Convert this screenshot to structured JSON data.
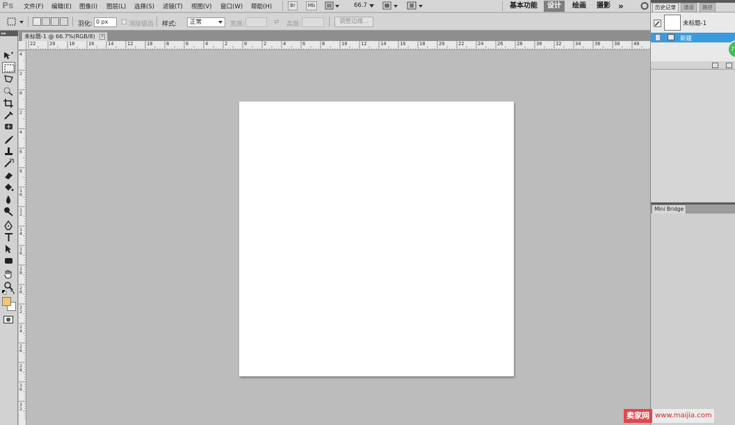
{
  "app": {
    "logo": "Ps",
    "menus": [
      "文件(F)",
      "编辑(E)",
      "图像(I)",
      "图层(L)",
      "选择(S)",
      "滤镜(T)",
      "视图(V)",
      "窗口(W)",
      "帮助(H)"
    ],
    "launch_bridge": "Br",
    "launch_minibridge": "Mb",
    "zoom": "66.7",
    "workspaces": [
      "基本功能",
      "设计",
      "绘画",
      "摄影"
    ],
    "active_workspace": "设计",
    "more_glyph": "»"
  },
  "options": {
    "feather_label": "羽化:",
    "feather_value": "0 px",
    "antialias_label": "消除锯齿",
    "style_label": "样式:",
    "style_value": "正常",
    "width_label": "宽度:",
    "height_label": "高度:",
    "refine_edge_label": "调整边缘..."
  },
  "document": {
    "tab_title": "未标题-1 @ 66.7%(RGB/8)",
    "close_glyph": "×",
    "canvas_color": "#ffffff"
  },
  "rulers": {
    "horizontal": [
      "22",
      "20",
      "18",
      "16",
      "14",
      "12",
      "10",
      "8",
      "6",
      "4",
      "2",
      "0",
      "2",
      "4",
      "6",
      "8",
      "10",
      "12",
      "14",
      "16",
      "18",
      "20",
      "22",
      "24",
      "26",
      "28",
      "30",
      "32",
      "34",
      "36",
      "38",
      "40"
    ],
    "vertical": [
      "4",
      "2",
      "0",
      "2",
      "4",
      "6",
      "8",
      "10",
      "12",
      "14",
      "16",
      "18",
      "20",
      "22",
      "24",
      "26",
      "28",
      "30",
      "32"
    ]
  },
  "tools": [
    "move-tool",
    "marquee-tool",
    "lasso-tool",
    "quick-select-tool",
    "crop-tool",
    "eyedropper-tool",
    "healing-brush-tool",
    "brush-tool",
    "clone-stamp-tool",
    "history-brush-tool",
    "eraser-tool",
    "paint-bucket-tool",
    "blur-tool",
    "dodge-tool",
    "pen-tool",
    "type-tool",
    "path-select-tool",
    "shape-tool",
    "hand-tool",
    "zoom-tool"
  ],
  "colors": {
    "foreground": "#f4c471",
    "background": "#ffffff",
    "selection_highlight": "#3b9bdf",
    "active_workspace_bg": "#7e7e7e"
  },
  "panels": {
    "history": {
      "tabs": [
        "历史记录",
        "通道",
        "路径"
      ],
      "active_tab": "历史记录",
      "snapshot_label": "未标题-1",
      "states": [
        "新建"
      ],
      "badge_text": "7"
    },
    "minibridge": {
      "tab": "Mini Bridge"
    }
  },
  "watermark": {
    "brand": "卖家网",
    "url": "www.maijia.com"
  }
}
